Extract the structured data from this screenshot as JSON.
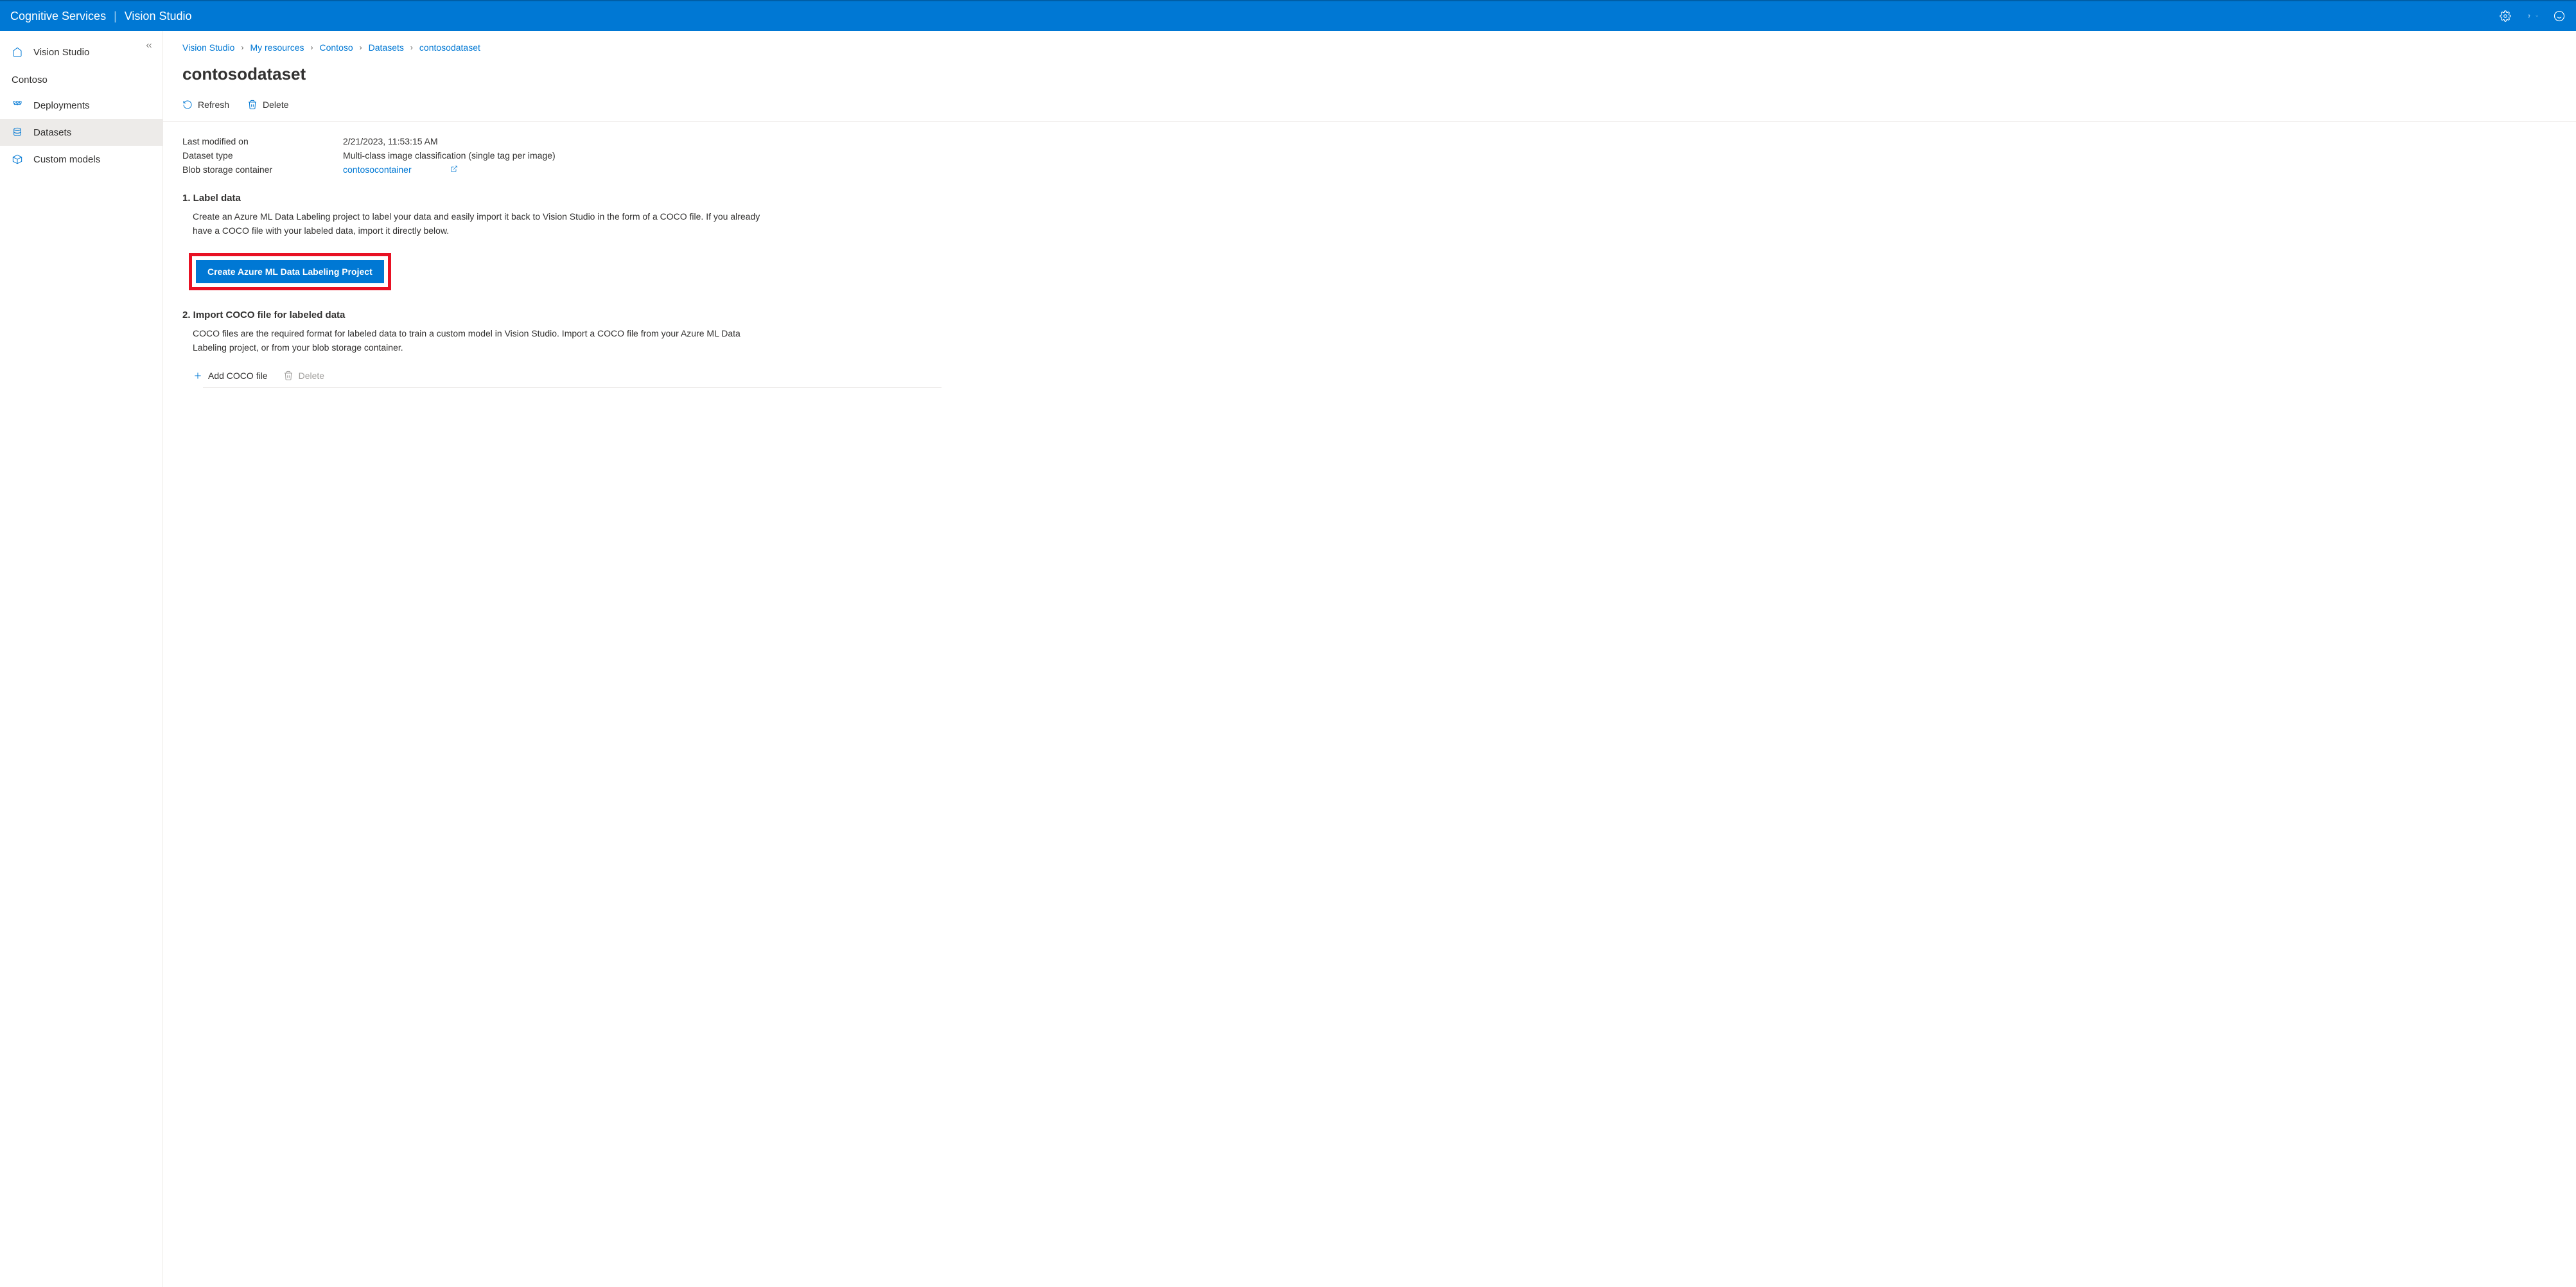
{
  "header": {
    "brand": "Cognitive Services",
    "product": "Vision Studio"
  },
  "sidebar": {
    "home_label": "Vision Studio",
    "resource_heading": "Contoso",
    "items": [
      {
        "label": "Deployments"
      },
      {
        "label": "Datasets"
      },
      {
        "label": "Custom models"
      }
    ]
  },
  "breadcrumb": [
    "Vision Studio",
    "My resources",
    "Contoso",
    "Datasets",
    "contosodataset"
  ],
  "page_title": "contosodataset",
  "toolbar": {
    "refresh_label": "Refresh",
    "delete_label": "Delete"
  },
  "meta": {
    "last_modified_label": "Last modified on",
    "last_modified_value": "2/21/2023, 11:53:15 AM",
    "dataset_type_label": "Dataset type",
    "dataset_type_value": "Multi-class image classification (single tag per image)",
    "blob_label": "Blob storage container",
    "blob_value": "contosocontainer"
  },
  "section1": {
    "heading": "1. Label data",
    "desc": "Create an Azure ML Data Labeling project to label your data and easily import it back to Vision Studio in the form of a COCO file. If you already have a COCO file with your labeled data, import it directly below.",
    "button_label": "Create Azure ML Data Labeling Project"
  },
  "section2": {
    "heading": "2. Import COCO file for labeled data",
    "desc": "COCO files are the required format for labeled data to train a custom model in Vision Studio. Import a COCO file from your Azure ML Data Labeling project, or from your blob storage container.",
    "add_label": "Add COCO file",
    "delete_label": "Delete"
  }
}
